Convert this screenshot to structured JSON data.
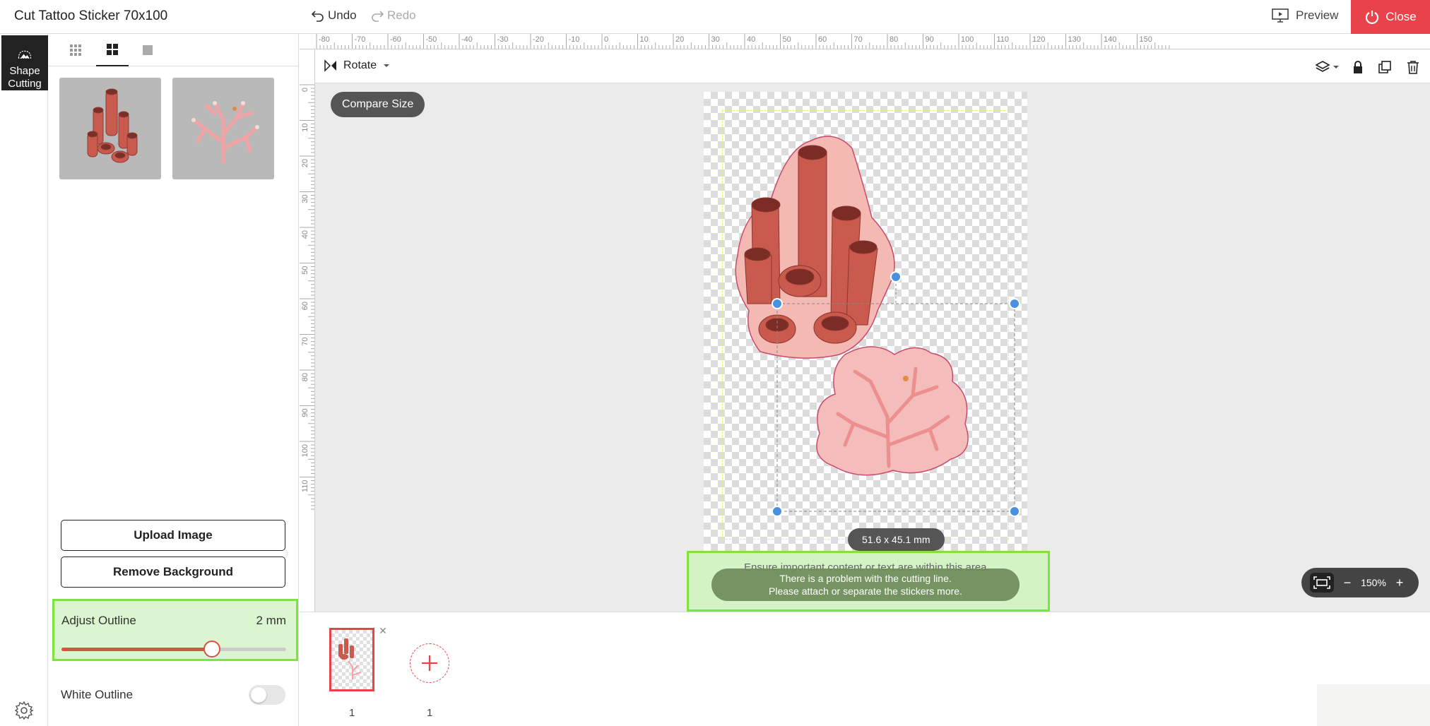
{
  "header": {
    "title": "Cut Tattoo Sticker 70x100",
    "undo_label": "Undo",
    "redo_label": "Redo",
    "preview_label": "Preview",
    "close_label": "Close"
  },
  "rail": {
    "tool_label": "Shape Cutting"
  },
  "panel": {
    "view_tabs": [
      "grid-small-icon",
      "grid-large-icon",
      "single-view-icon"
    ],
    "thumbnails": [
      {
        "name": "red-tube-coral"
      },
      {
        "name": "pink-branch-coral"
      }
    ],
    "upload_label": "Upload Image",
    "remove_bg_label": "Remove Background",
    "adjust_outline": {
      "label": "Adjust Outline",
      "value_text": "2 mm",
      "level": 0.67
    },
    "white_outline": {
      "label": "White Outline",
      "enabled": false
    }
  },
  "rulers": {
    "top_labels": [
      "-80",
      "-70",
      "-60",
      "-50",
      "-40",
      "-30",
      "-20",
      "-10",
      "0",
      "10",
      "20",
      "30",
      "40",
      "50",
      "60",
      "70",
      "80",
      "90",
      "100",
      "110",
      "120",
      "130",
      "140",
      "150"
    ],
    "left_labels": [
      "0",
      "10",
      "20",
      "30",
      "40",
      "50",
      "60",
      "70",
      "80",
      "90",
      "100",
      "110"
    ]
  },
  "toolbar": {
    "rotate_label": "Rotate",
    "icons": [
      "layers-icon",
      "lock-icon",
      "duplicate-icon",
      "trash-icon"
    ]
  },
  "canvas": {
    "compare_label": "Compare Size",
    "size_text": "51.6 x 45.1 mm",
    "safe_area_hint": "Ensure important content or text are within this area.",
    "warning_line1": "There is a problem with the cutting line.",
    "warning_line2": "Please attach or separate the stickers more.",
    "zoom_text": "150%"
  },
  "pages": {
    "items": [
      {
        "number": "1"
      }
    ],
    "count_text": "1"
  },
  "colors": {
    "accent": "#e8424b",
    "highlight": "#7ee33c",
    "slider": "#d6533f",
    "coral_red": "#c85a4e",
    "coral_pink": "#f2a3a3"
  }
}
